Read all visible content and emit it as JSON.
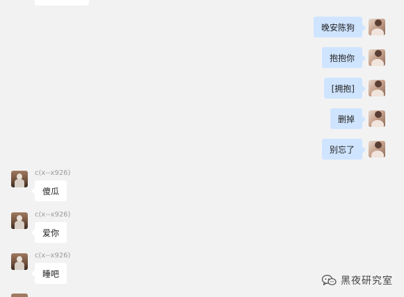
{
  "outgoing": [
    {
      "text": "晚安陈狗"
    },
    {
      "text": "抱抱你"
    },
    {
      "text": "[拥抱]"
    },
    {
      "text": "删掉"
    },
    {
      "text": "别忘了"
    }
  ],
  "incoming": [
    {
      "sender": "c(x--x926)",
      "text": "傻瓜"
    },
    {
      "sender": "c(x--x926)",
      "text": "爱你"
    },
    {
      "sender": "c(x--x926)",
      "text": "睡吧"
    }
  ],
  "watermark": {
    "text": "黑夜研究室",
    "icon": "wechat-official-account-icon"
  },
  "colors": {
    "background": "#f2f2f2",
    "outgoing_bubble": "#cfe4ff",
    "incoming_bubble": "#ffffff",
    "sender_name": "#9a9a9a"
  }
}
